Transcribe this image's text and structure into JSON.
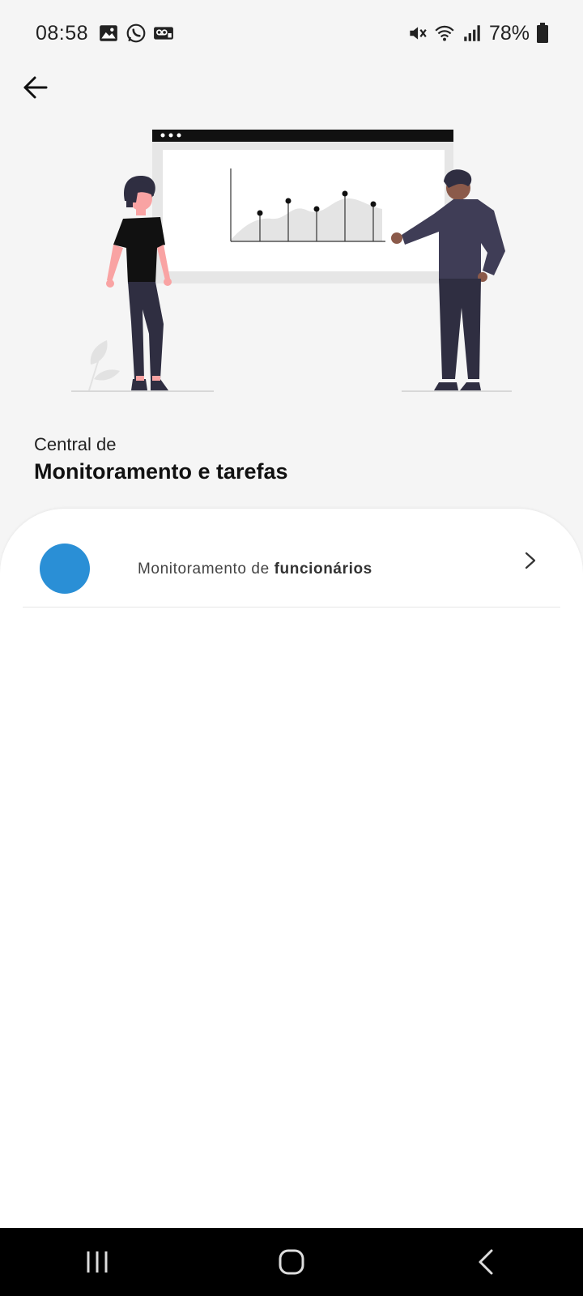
{
  "status_bar": {
    "time": "08:58",
    "battery": "78%",
    "icons_left": [
      "gallery-icon",
      "whatsapp-icon",
      "voicemail-icon"
    ],
    "icons_right": [
      "mute-icon",
      "wifi-icon",
      "signal-icon",
      "battery-icon"
    ]
  },
  "header": {
    "back_icon": "arrow-left-icon"
  },
  "heading": {
    "subtitle": "Central de",
    "title": "Monitoramento e tarefas"
  },
  "list": {
    "items": [
      {
        "label_prefix": "Monitoramento de ",
        "label_bold": "funcionários",
        "avatar_color": "#2a8fd6",
        "chevron": "chevron-right-icon"
      }
    ]
  },
  "nav_bar": {
    "buttons": [
      "recent-apps-icon",
      "home-icon",
      "back-nav-icon"
    ]
  },
  "colors": {
    "background": "#f5f5f5",
    "sheet": "#ffffff",
    "accent": "#2a8fd6"
  }
}
